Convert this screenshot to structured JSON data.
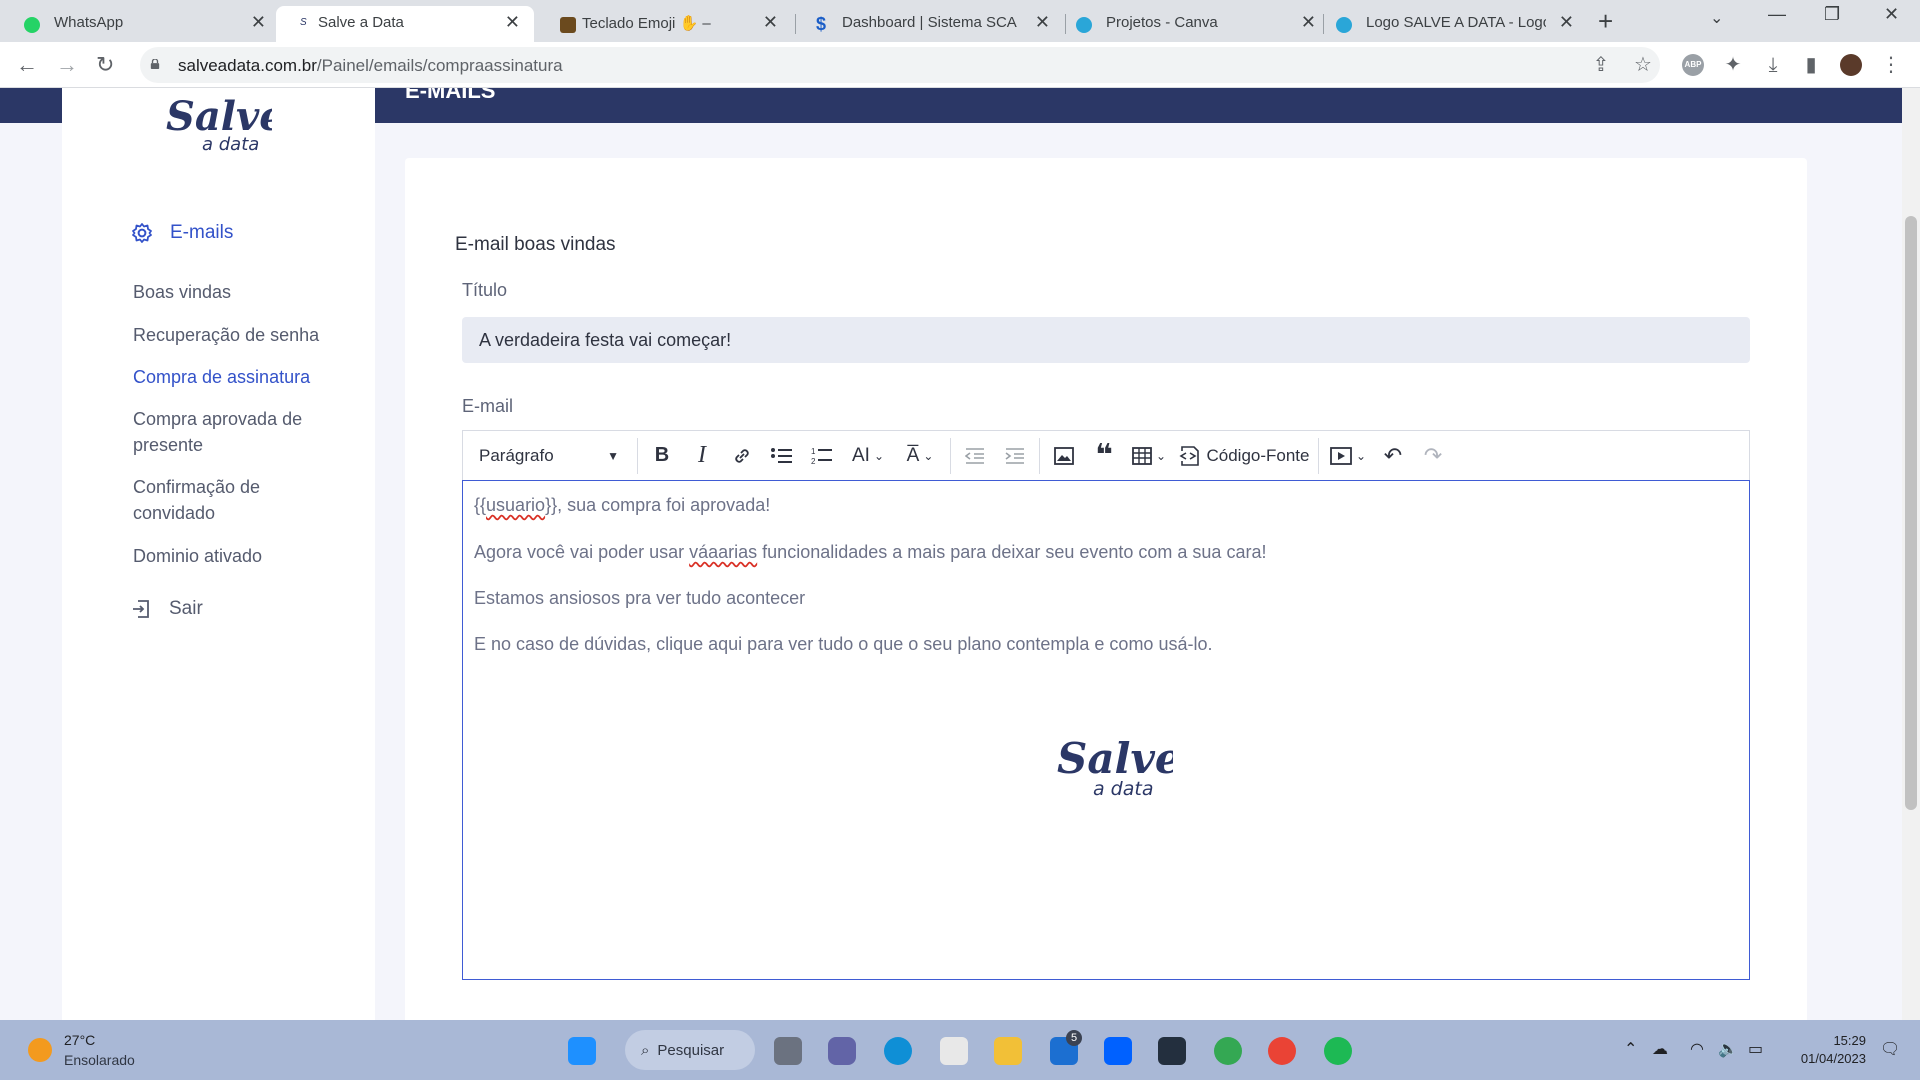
{
  "browser": {
    "tabs": [
      {
        "title": "WhatsApp",
        "favicon": "whatsapp-icon",
        "active": false
      },
      {
        "title": "Salve a Data",
        "favicon": "salve-icon",
        "active": true
      },
      {
        "title": "Teclado Emoji ✋ –",
        "favicon": "emoji-icon",
        "active": false
      },
      {
        "title": "Dashboard | Sistema SCA",
        "favicon": "dollar-icon",
        "active": false
      },
      {
        "title": "Projetos - Canva",
        "favicon": "canva-icon",
        "active": false
      },
      {
        "title": "Logo SALVE A DATA - Logo",
        "favicon": "canva-icon",
        "active": false
      }
    ],
    "url_host": "salveadata.com.br",
    "url_path": "/Painel/emails/compraassinatura"
  },
  "header": {
    "band_title": "E-MAILS"
  },
  "logo": {
    "line1": "Salve",
    "line2": "a data"
  },
  "sidebar": {
    "section_label": "E-mails",
    "items": [
      {
        "label": "Boas vindas",
        "active": false
      },
      {
        "label": "Recuperação de senha",
        "active": false
      },
      {
        "label": "Compra de assinatura",
        "active": true
      },
      {
        "label": "Compra aprovada de presente",
        "active": false
      },
      {
        "label": "Confirmação de convidado",
        "active": false
      },
      {
        "label": "Dominio ativado",
        "active": false
      }
    ],
    "logout_label": "Sair"
  },
  "main": {
    "card_title": "E-mail boas vindas",
    "title_label": "Título",
    "title_value": "A verdadeira festa vai começar!",
    "email_label": "E-mail",
    "editor_toolbar": {
      "paragraph_select": "Parágrafo",
      "source_code_label": "Código-Fonte"
    },
    "email_body": {
      "line1_token": "{{",
      "line1_token_word": "usuario",
      "line1_rest": "}}, sua compra foi aprovada!",
      "line2_before": "Agora você vai poder usar ",
      "line2_misspelled": "váaarias",
      "line2_after": " funcionalidades a mais para deixar seu evento com a sua cara!",
      "line3": "Estamos ansiosos pra ver tudo acontecer",
      "line4": "E no caso de dúvidas, clique aqui para ver tudo o que o seu plano contempla e como usá-lo."
    }
  },
  "taskbar": {
    "weather_temp": "27°C",
    "weather_desc": "Ensolarado",
    "search_label": "Pesquisar",
    "mail_badge": "5",
    "time": "15:29",
    "date": "01/04/2023"
  },
  "colors": {
    "brand_navy": "#2b3766",
    "accent_blue": "#3352c9",
    "text_gray": "#555b6e"
  }
}
